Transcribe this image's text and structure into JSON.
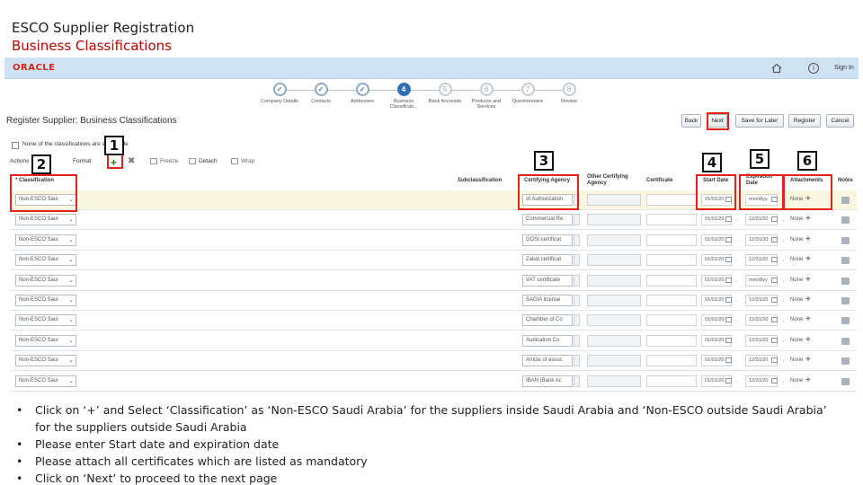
{
  "slide": {
    "title": "ESCO Supplier  Registration",
    "subtitle": "Business Classifications"
  },
  "app": {
    "logo": "ORACLE",
    "signin": "Sign In",
    "accent_color": "#2f6fb5",
    "highlight_color": "#e2231a"
  },
  "train": [
    {
      "label": "Company Details",
      "num": "✓",
      "state": "done"
    },
    {
      "label": "Contacts",
      "num": "✓",
      "state": "done"
    },
    {
      "label": "Addresses",
      "num": "✓",
      "state": "done"
    },
    {
      "label": "Business Classificati...",
      "num": "4",
      "state": "active"
    },
    {
      "label": "Bank Accounts",
      "num": "5",
      "state": "todo"
    },
    {
      "label": "Products and Services",
      "num": "6",
      "state": "todo"
    },
    {
      "label": "Questionnaire",
      "num": "7",
      "state": "todo"
    },
    {
      "label": "Review",
      "num": "8",
      "state": "todo"
    }
  ],
  "page": {
    "heading": "Register Supplier: Business Classifications",
    "buttons": {
      "back": "Back",
      "next": "Next",
      "save_for_later": "Save for Later",
      "register": "Register",
      "cancel": "Cancel"
    },
    "none_label": "None of the classifications are applicable",
    "toolbar": {
      "actions": "Actions",
      "format": "Format",
      "freeze": "Freeze",
      "detach": "Detach",
      "wrap": "Wrap"
    }
  },
  "table": {
    "headers": {
      "classification": "* Classification",
      "subclassification": "Subclassification",
      "certifying_agency": "Certifying Agency",
      "other_agency": "Other Certifying Agency",
      "certificate": "Certificate",
      "start_date": "Start Date",
      "expiration_date": "Expiration Date",
      "attachments": "Attachments",
      "notes": "Notes"
    },
    "rows": [
      {
        "classification": "Non-ESCO Saui",
        "agency": "of Authorization",
        "start": "01/01/20",
        "expiry": "mm/d/yy",
        "attach": "None"
      },
      {
        "classification": "Non-ESCO Saui",
        "agency": "Commercial Re",
        "start": "01/01/20",
        "expiry": "12/31/20",
        "attach": "None"
      },
      {
        "classification": "Non-ESCO Saui",
        "agency": "GOSI certificat",
        "start": "01/01/20",
        "expiry": "12/31/20",
        "attach": "None"
      },
      {
        "classification": "Non-ESCO Saui",
        "agency": "Zakat certificat",
        "start": "01/01/20",
        "expiry": "12/31/20",
        "attach": "None"
      },
      {
        "classification": "Non-ESCO Saui",
        "agency": "VAT certificate",
        "start": "01/01/20",
        "expiry": "mm/d/yy",
        "attach": "None"
      },
      {
        "classification": "Non-ESCO Saui",
        "agency": "SAGIA license",
        "start": "01/01/20",
        "expiry": "12/31/20",
        "attach": "None"
      },
      {
        "classification": "Non-ESCO Saui",
        "agency": "Chamber of Co",
        "start": "01/01/20",
        "expiry": "12/31/20",
        "attach": "None"
      },
      {
        "classification": "Non-ESCO Saui",
        "agency": "Audication Co",
        "start": "01/01/20",
        "expiry": "12/31/20",
        "attach": "None"
      },
      {
        "classification": "Non-ESCO Saui",
        "agency": "Article of assoc",
        "start": "01/01/20",
        "expiry": "12/31/20",
        "attach": "None"
      },
      {
        "classification": "Non-ESCO Saui",
        "agency": "IBAN (Bank Ac",
        "start": "01/01/20",
        "expiry": "12/31/20",
        "attach": "None"
      }
    ]
  },
  "callouts": [
    "1",
    "2",
    "3",
    "4",
    "5",
    "6"
  ],
  "instructions": [
    "Click on ‘+’ and Select ‘Classification’ as ‘Non-ESCO Saudi Arabia’ for the suppliers inside Saudi Arabia and ‘Non-ESCO outside Saudi Arabia’ for the suppliers outside Saudi Arabia",
    "Please enter Start date and expiration date",
    "Please attach all certificates which are listed as mandatory",
    "Click on ‘Next’ to proceed to the next page"
  ]
}
